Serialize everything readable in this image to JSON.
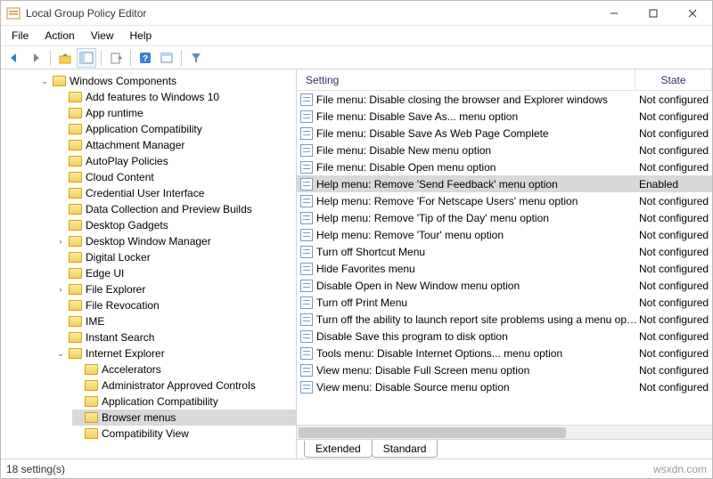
{
  "window": {
    "title": "Local Group Policy Editor"
  },
  "menubar": [
    "File",
    "Action",
    "View",
    "Help"
  ],
  "tree": {
    "root": {
      "label": "Windows Components",
      "expanded": true
    },
    "items": [
      {
        "label": "Add features to Windows 10"
      },
      {
        "label": "App runtime"
      },
      {
        "label": "Application Compatibility"
      },
      {
        "label": "Attachment Manager"
      },
      {
        "label": "AutoPlay Policies"
      },
      {
        "label": "Cloud Content"
      },
      {
        "label": "Credential User Interface"
      },
      {
        "label": "Data Collection and Preview Builds"
      },
      {
        "label": "Desktop Gadgets"
      },
      {
        "label": "Desktop Window Manager",
        "twisty": ">"
      },
      {
        "label": "Digital Locker"
      },
      {
        "label": "Edge UI"
      },
      {
        "label": "File Explorer",
        "twisty": ">"
      },
      {
        "label": "File Revocation"
      },
      {
        "label": "IME"
      },
      {
        "label": "Instant Search"
      },
      {
        "label": "Internet Explorer",
        "twisty": "v",
        "children": [
          {
            "label": "Accelerators"
          },
          {
            "label": "Administrator Approved Controls"
          },
          {
            "label": "Application Compatibility"
          },
          {
            "label": "Browser menus",
            "selected": true
          },
          {
            "label": "Compatibility View"
          }
        ]
      }
    ]
  },
  "list": {
    "columns": {
      "setting": "Setting",
      "state": "State"
    },
    "col_widths": {
      "setting": 380,
      "state": 100
    },
    "rows": [
      {
        "name": "File menu: Disable closing the browser and Explorer windows",
        "state": "Not configured"
      },
      {
        "name": "File menu: Disable Save As... menu option",
        "state": "Not configured"
      },
      {
        "name": "File menu: Disable Save As Web Page Complete",
        "state": "Not configured"
      },
      {
        "name": "File menu: Disable New menu option",
        "state": "Not configured"
      },
      {
        "name": "File menu: Disable Open menu option",
        "state": "Not configured"
      },
      {
        "name": "Help menu: Remove 'Send Feedback' menu option",
        "state": "Enabled",
        "selected": true
      },
      {
        "name": "Help menu: Remove 'For Netscape Users' menu option",
        "state": "Not configured"
      },
      {
        "name": "Help menu: Remove 'Tip of the Day' menu option",
        "state": "Not configured"
      },
      {
        "name": "Help menu: Remove 'Tour' menu option",
        "state": "Not configured"
      },
      {
        "name": "Turn off Shortcut Menu",
        "state": "Not configured"
      },
      {
        "name": "Hide Favorites menu",
        "state": "Not configured"
      },
      {
        "name": "Disable Open in New Window menu option",
        "state": "Not configured"
      },
      {
        "name": "Turn off Print Menu",
        "state": "Not configured"
      },
      {
        "name": "Turn off the ability to launch report site problems using a menu option",
        "state": "Not configured"
      },
      {
        "name": "Disable Save this program to disk option",
        "state": "Not configured"
      },
      {
        "name": "Tools menu: Disable Internet Options... menu option",
        "state": "Not configured"
      },
      {
        "name": "View menu: Disable Full Screen menu option",
        "state": "Not configured"
      },
      {
        "name": "View menu: Disable Source menu option",
        "state": "Not configured"
      }
    ]
  },
  "tabs": {
    "extended": "Extended",
    "standard": "Standard"
  },
  "statusbar": {
    "text": "18 setting(s)",
    "watermark": "wsxdn.com"
  }
}
